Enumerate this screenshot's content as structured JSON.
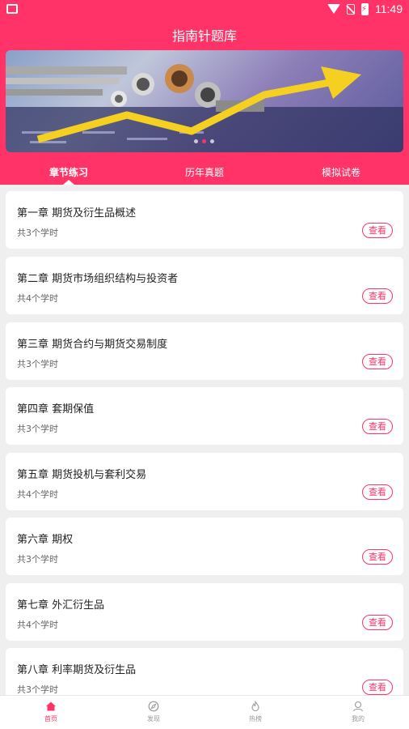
{
  "status": {
    "time": "11:49"
  },
  "app": {
    "title": "指南针题库"
  },
  "tabs": [
    {
      "label": "章节练习"
    },
    {
      "label": "历年真题"
    },
    {
      "label": "模拟试卷"
    }
  ],
  "chapters": [
    {
      "title": "第一章 期货及衍生品概述",
      "hours": "共3个学时",
      "button": "查看"
    },
    {
      "title": "第二章 期货市场组织结构与投资者",
      "hours": "共4个学时",
      "button": "查看"
    },
    {
      "title": "第三章 期货合约与期货交易制度",
      "hours": "共3个学时",
      "button": "查看"
    },
    {
      "title": "第四章 套期保值",
      "hours": "共3个学时",
      "button": "查看"
    },
    {
      "title": "第五章 期货投机与套利交易",
      "hours": "共4个学时",
      "button": "查看"
    },
    {
      "title": "第六章 期权",
      "hours": "共3个学时",
      "button": "查看"
    },
    {
      "title": "第七章 外汇衍生品",
      "hours": "共4个学时",
      "button": "查看"
    },
    {
      "title": "第八章 利率期货及衍生品",
      "hours": "共3个学时",
      "button": "查看"
    }
  ],
  "nav": [
    {
      "label": "首页",
      "icon": "home-icon"
    },
    {
      "label": "发现",
      "icon": "compass-icon"
    },
    {
      "label": "热榜",
      "icon": "flame-icon"
    },
    {
      "label": "我的",
      "icon": "user-icon"
    }
  ],
  "colors": {
    "accent": "#ff3367",
    "background": "#efefef",
    "card": "#ffffff"
  }
}
